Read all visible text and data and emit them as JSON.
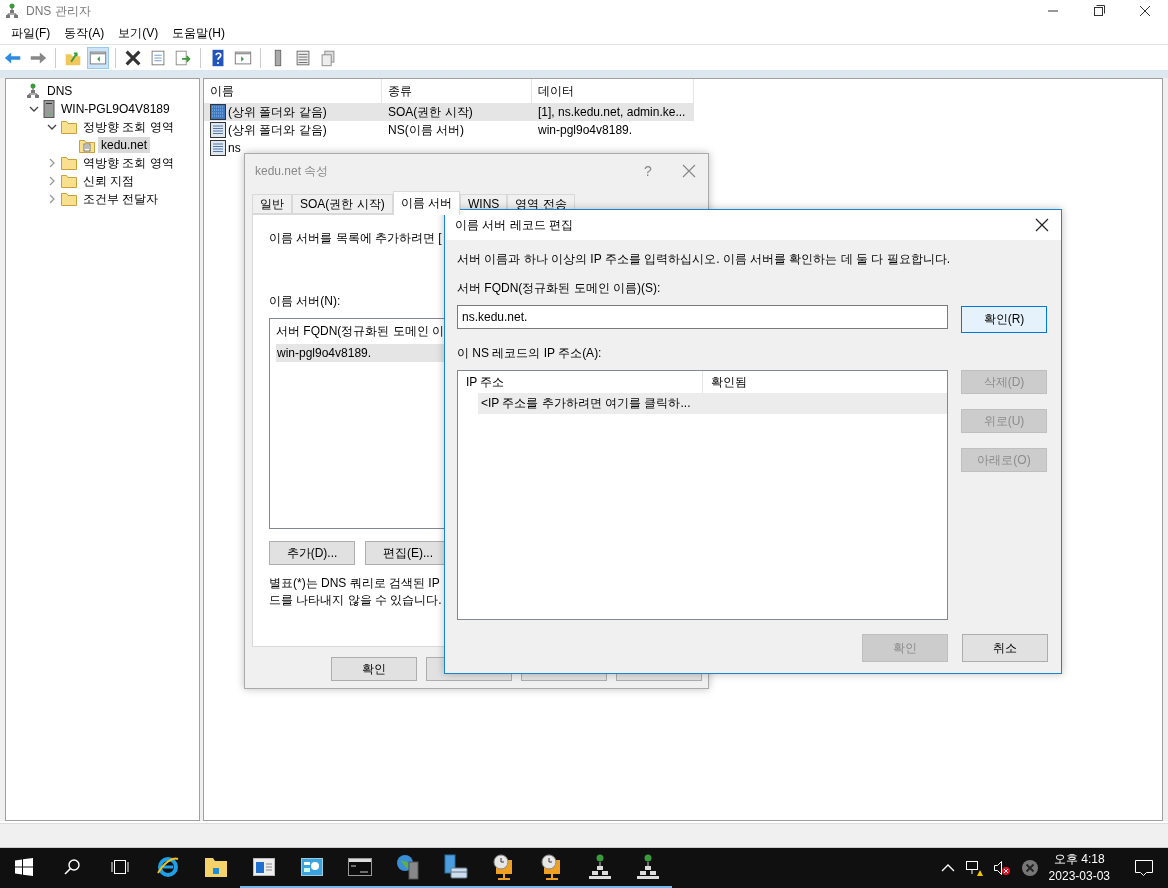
{
  "window": {
    "title": "DNS 관리자"
  },
  "menu": [
    "파일(F)",
    "동작(A)",
    "보기(V)",
    "도움말(H)"
  ],
  "toolbar": {
    "console_tree_shown": true
  },
  "tree": [
    {
      "label": "DNS",
      "kind": "dns",
      "selected": false,
      "children": [
        {
          "label": "WIN-PGL9O4V8189",
          "kind": "server",
          "selected": false,
          "expanded": true,
          "children": [
            {
              "label": "정방향 조회 영역",
              "kind": "folder",
              "selected": false,
              "expanded": true,
              "children": [
                {
                  "label": "kedu.net",
                  "kind": "zone",
                  "selected": true
                }
              ]
            },
            {
              "label": "역방향 조회 영역",
              "kind": "folder",
              "selected": false,
              "expanded": false
            },
            {
              "label": "신뢰 지점",
              "kind": "folder",
              "selected": false,
              "expanded": false
            },
            {
              "label": "조건부 전달자",
              "kind": "folder",
              "selected": false,
              "expanded": false
            }
          ]
        }
      ]
    }
  ],
  "records": {
    "columns": [
      "이름",
      "종류",
      "데이터"
    ],
    "rows": [
      {
        "kind": "soa",
        "name": "(상위 폴더와 같음)",
        "type": "SOA(권한 시작)",
        "data": "[1], ns.kedu.net, admin.ke...",
        "selected": true
      },
      {
        "kind": "record",
        "name": "(상위 폴더와 같음)",
        "type": "NS(이름 서버)",
        "data": "win-pgl9o4v8189.",
        "selected": false
      },
      {
        "kind": "record",
        "name": "ns",
        "selected": false
      }
    ]
  },
  "properties_dialog": {
    "title": "kedu.net 속성",
    "help_glyph": "?",
    "tabs": [
      {
        "label": "일반",
        "selected": false
      },
      {
        "label": "SOA(권한 시작)",
        "selected": false
      },
      {
        "label": "이름 서버",
        "selected": true
      },
      {
        "label": "WINS",
        "selected": false
      },
      {
        "label": "영역 전송",
        "selected": false
      }
    ],
    "instruction": "이름 서버를 목록에 추가하려면 [",
    "list_label": "이름 서버(N):",
    "list_header": "서버 FQDN(정규화된 도메인 이",
    "list_rows": [
      {
        "text": "win-pgl9o4v8189.",
        "selected": true
      }
    ],
    "buttons": [
      "추가(D)...",
      "편집(E)..."
    ],
    "note_lines": [
      "별표(*)는 DNS 쿼리로 검색된 IP",
      "드를 나타내지 않을 수 있습니다."
    ],
    "footer_buttons": [
      {
        "kind": "labeled",
        "label": "확인"
      },
      {
        "kind": "covered"
      },
      {
        "kind": "covered"
      },
      {
        "kind": "covered"
      }
    ]
  },
  "edit_dialog": {
    "title": "이름 서버 레코드 편집",
    "instruction": "서버 이름과 하나 이상의 IP 주소를 입력하십시오. 이름 서버를 확인하는 데 둘 다 필요합니다.",
    "fqdn_label": "서버 FQDN(정규화된 도메인 이름)(S):",
    "fqdn_value": "ns.kedu.net.",
    "resolve_button": {
      "label": "확인(R)",
      "disabled": false
    },
    "ip_label": "이 NS 레코드의 IP 주소(A):",
    "ip_columns": [
      "IP 주소",
      "확인됨"
    ],
    "ip_placeholder": "<IP 주소를 추가하려면 여기를 클릭하...",
    "side_buttons": [
      {
        "label": "삭제(D)",
        "disabled": true
      },
      {
        "label": "위로(U)",
        "disabled": true
      },
      {
        "label": "아래로(O)",
        "disabled": true
      }
    ],
    "footer_buttons": [
      {
        "label": "확인",
        "disabled": true
      },
      {
        "label": "취소",
        "disabled": false
      }
    ]
  },
  "taskbar": {
    "apps": [
      {
        "kind": "browser",
        "running": false
      },
      {
        "kind": "folder",
        "running": false
      },
      {
        "kind": "window",
        "running": true
      },
      {
        "kind": "dashboard",
        "running": true
      },
      {
        "kind": "terminal",
        "running": true
      },
      {
        "kind": "globe-server",
        "running": true
      },
      {
        "kind": "server-case",
        "running": true
      },
      {
        "kind": "clock-tree",
        "running": true
      },
      {
        "kind": "clock-tree",
        "running": true
      },
      {
        "kind": "network",
        "running": true
      },
      {
        "kind": "network",
        "running": true
      }
    ],
    "time": "오후 4:18",
    "date": "2023-03-03"
  }
}
